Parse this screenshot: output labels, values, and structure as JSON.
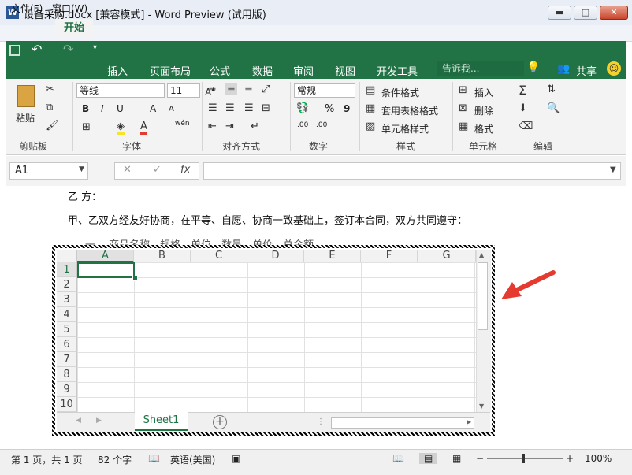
{
  "window": {
    "title": "设备采购.docx [兼容模式] - Word Preview (试用版)",
    "controls": {
      "minimize": "▬",
      "maximize": "□",
      "close": "✕"
    }
  },
  "menu": {
    "items": [
      "文件(F)",
      "窗口(W)"
    ]
  },
  "ribbon": {
    "tabs": [
      "开始",
      "插入",
      "页面布局",
      "公式",
      "数据",
      "审阅",
      "视图",
      "开发工具"
    ],
    "search_placeholder": "告诉我...",
    "share_label": "共享",
    "clipboard": {
      "paste": "粘贴",
      "group": "剪贴板"
    },
    "font": {
      "name": "等线",
      "size": "11",
      "bold": "B",
      "italic": "I",
      "underline": "U",
      "group": "字体",
      "phonetic": "wén"
    },
    "alignment": {
      "group": "对齐方式"
    },
    "number": {
      "format": "常规",
      "percent": "%",
      "comma": "9",
      "group": "数字"
    },
    "styles": {
      "conditional": "条件格式",
      "table": "套用表格格式",
      "cell": "单元格样式",
      "group": "样式"
    },
    "cells": {
      "insert": "插入",
      "delete": "删除",
      "format": "格式",
      "group": "单元格"
    },
    "editing": {
      "group": "编辑"
    }
  },
  "formula_bar": {
    "name_box": "A1",
    "fx": "fx",
    "value": ""
  },
  "document": {
    "line1": "乙      方：",
    "line2": "甲、乙双方经友好协商，在平等、自愿、协商一致基础上，签订本合同，双方共同遵守：",
    "line3": "一、   商品名称、规格、单位、数量、单价、总金额"
  },
  "sheet": {
    "columns": [
      "A",
      "B",
      "C",
      "D",
      "E",
      "F",
      "G"
    ],
    "rows": [
      "1",
      "2",
      "3",
      "4",
      "5",
      "6",
      "7",
      "8",
      "9",
      "10"
    ],
    "active_tab": "Sheet1",
    "add_sheet": "+"
  },
  "status": {
    "page": "第 1 页，共 1 页",
    "words": "82 个字",
    "language": "英语(美国)",
    "zoom": "100%",
    "zoom_minus": "−",
    "zoom_plus": "+"
  },
  "colors": {
    "accent": "#217346",
    "arrow": "#e53a2f"
  }
}
